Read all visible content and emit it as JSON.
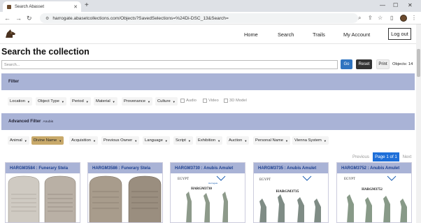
{
  "browser": {
    "tab_title": "Search Abasset",
    "url": "harrogate.abasetcollections.com/Objects?SavedSelections=%24Di-DSC_13&Search="
  },
  "nav": {
    "home": "Home",
    "search": "Search",
    "trails": "Trails",
    "my_account": "My Account",
    "logout": "Log out"
  },
  "page": {
    "title": "Search the collection",
    "search_placeholder": "Search...",
    "go": "Go",
    "reset": "Reset",
    "print": "Print",
    "objects_count": "Objects: 14"
  },
  "filter": {
    "label": "Filter",
    "dropdowns": [
      "Location",
      "Object Type",
      "Period",
      "Material",
      "Provenance",
      "Culture"
    ],
    "checkboxes": [
      "Audio",
      "Video",
      "3D Model"
    ]
  },
  "advanced": {
    "label": "Advanced Filter",
    "sub": "Anubis",
    "dropdowns": [
      "Animal",
      "Divine Name",
      "Acquisition",
      "Previous Owner",
      "Language",
      "Script",
      "Exhibition",
      "Auction",
      "Personal Name",
      "Vienna System"
    ]
  },
  "pager": {
    "prev": "Previous",
    "current": "Page 1 of 1",
    "next": "Next"
  },
  "cards": [
    {
      "title": "HARGM3584 : Funerary Stela",
      "label": ""
    },
    {
      "title": "HARGM3586 : Funerary Stela",
      "label": ""
    },
    {
      "title": "HARGM3730 : Anubis Amulet",
      "label": "HARGM3730"
    },
    {
      "title": "HARGM3735 : Anubis Amulet",
      "label": "HARGM3735"
    },
    {
      "title": "HARGM3752 : Anubis Amulet",
      "label": "HARGM3752"
    }
  ],
  "colors": {
    "panel": "#a9b3d6",
    "accent": "#2f74c0",
    "active_filter": "#c8a96a"
  }
}
